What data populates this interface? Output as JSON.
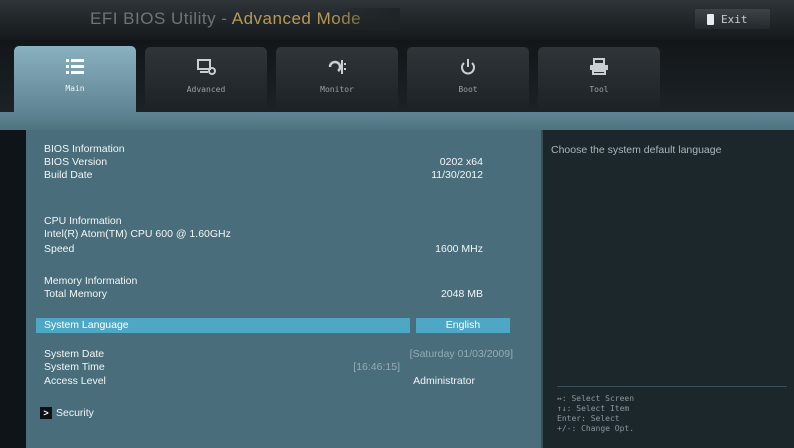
{
  "titlebar": {
    "title_prefix": "EFI BIOS Utility - ",
    "title_accent": "Advanced Mode",
    "exit_label": "Exit"
  },
  "tabs": [
    {
      "label": "Main",
      "icon": "list-icon",
      "active": true
    },
    {
      "label": "Advanced",
      "icon": "advanced-icon",
      "active": false
    },
    {
      "label": "Monitor",
      "icon": "monitor-icon",
      "active": false
    },
    {
      "label": "Boot",
      "icon": "power-icon",
      "active": false
    },
    {
      "label": "Tool",
      "icon": "printer-icon",
      "active": false
    }
  ],
  "main": {
    "bios_info": {
      "heading": "BIOS Information",
      "version_label": "BIOS Version",
      "version_value": "0202 x64",
      "build_label": "Build Date",
      "build_value": "11/30/2012"
    },
    "cpu_info": {
      "heading": "CPU Information",
      "model": "Intel(R) Atom(TM) CPU 600 @ 1.60GHz",
      "speed_label": "Speed",
      "speed_value": "1600 MHz"
    },
    "memory_info": {
      "heading": "Memory Information",
      "total_label": "Total Memory",
      "total_value": "2048 MB"
    },
    "language": {
      "label": "System Language",
      "value": "English"
    },
    "date": {
      "label": "System Date",
      "value": "[Saturday 01/03/2009]"
    },
    "time": {
      "label": "System Time",
      "value": "[16:46:15]"
    },
    "access": {
      "label": "Access Level",
      "value": "Administrator"
    },
    "security": {
      "label": "Security"
    }
  },
  "side": {
    "help_text": "Choose the system default language",
    "hints": [
      "↔: Select Screen",
      "↑↓: Select Item",
      "Enter: Select",
      "+/-: Change Opt."
    ]
  },
  "colors": {
    "accent": "#4fa7c6",
    "panel": "#4a6d7b",
    "title_accent": "#b79a55"
  }
}
